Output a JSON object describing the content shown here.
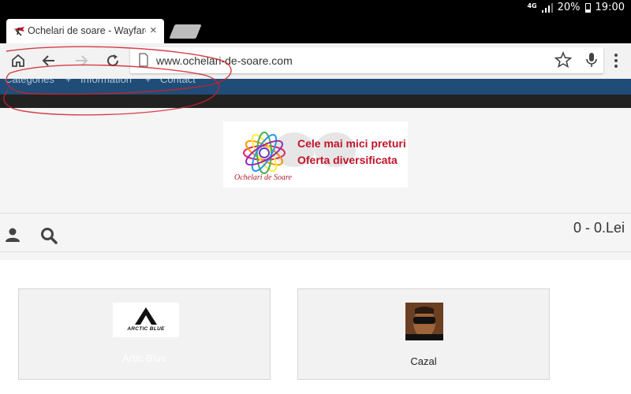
{
  "status_bar": {
    "network": "4G",
    "battery": "20%",
    "time": "19:00"
  },
  "tab": {
    "title": "Ochelari de soare - Wayfarer",
    "close_glyph": "×"
  },
  "toolbar": {
    "url": "www.ochelari-de-soare.com"
  },
  "site_nav": {
    "items": [
      "Categories",
      "Information",
      "Contact"
    ],
    "separator": "+"
  },
  "logo": {
    "slogan_line1": "Cele mai mici preturi",
    "slogan_line2": "Oferta diversificata",
    "name": "Ochelari de Soare"
  },
  "cart": {
    "summary": "0 - 0.Lei"
  },
  "brands": [
    {
      "label": "Artic Blue",
      "logo_text": "ARCTIC BLUE"
    },
    {
      "label": "Cazal"
    }
  ],
  "colors": {
    "nav_bar": "#1f4d78",
    "annotation": "#d0202a",
    "brand_red": "#c0142a"
  }
}
